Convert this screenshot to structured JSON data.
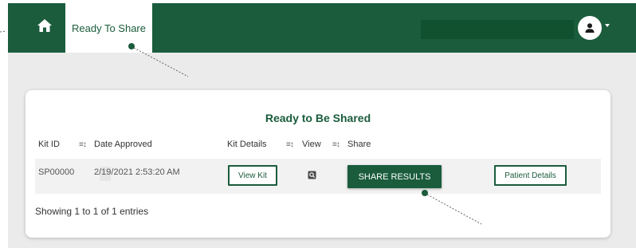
{
  "header": {
    "home_icon": "home-icon",
    "active_tab": "Ready To Share",
    "user_icon": "person-icon",
    "menu_caret_icon": "chevron-down-icon",
    "brand_color": "#1a5c3c"
  },
  "card": {
    "title": "Ready to Be Shared",
    "columns": [
      "Kit ID",
      "Date Approved",
      "Kit Details",
      "View",
      "Share"
    ],
    "sort_icon": "sort-icon",
    "rows": [
      {
        "kit_id": "SP00000",
        "date_approved": "2/19/2021 2:53:20 AM",
        "kit_details_button": "View Kit",
        "view_icon": "search-document-icon",
        "share_button": "SHARE RESULTS",
        "patient_button": "Patient Details"
      }
    ],
    "footer": "Showing 1 to 1 of 1 entries"
  }
}
